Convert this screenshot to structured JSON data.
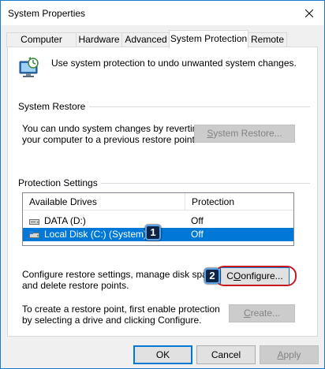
{
  "window": {
    "title": "System Properties",
    "close_icon": "close-icon"
  },
  "tabs": [
    {
      "label": "Computer Name",
      "active": false
    },
    {
      "label": "Hardware",
      "active": false
    },
    {
      "label": "Advanced",
      "active": false
    },
    {
      "label": "System Protection",
      "active": true
    },
    {
      "label": "Remote",
      "active": false
    }
  ],
  "intro": {
    "icon": "computer-shield-icon",
    "text": "Use system protection to undo unwanted system changes."
  },
  "system_restore": {
    "heading": "System Restore",
    "description_line1": "You can undo system changes by reverting",
    "description_line2": "your computer to a previous restore point.",
    "button_label_u": "S",
    "button_label_rest": "ystem Restore..."
  },
  "protection_settings": {
    "heading": "Protection Settings",
    "columns": [
      "Available Drives",
      "Protection"
    ],
    "drives": [
      {
        "name": "DATA (D:)",
        "protection": "Off",
        "selected": false,
        "icon": "drive-icon"
      },
      {
        "name": "Local Disk (C:) (System)",
        "protection": "Off",
        "selected": true,
        "icon": "system-drive-icon"
      }
    ]
  },
  "configure": {
    "description_line1": "Configure restore settings, manage disk space,",
    "description_line2": "and delete restore points.",
    "button_label_u": "O",
    "button_label_rest": "onfigure...",
    "button_label_prefix": "C"
  },
  "create": {
    "description_line1": "To create a restore point, first enable protection",
    "description_line2": "by selecting a drive and clicking Configure.",
    "button_label_u": "C",
    "button_label_rest": "reate..."
  },
  "markers": [
    "1",
    "2"
  ],
  "footer": {
    "ok": "OK",
    "cancel": "Cancel",
    "apply_u": "A",
    "apply_rest": "pply"
  },
  "colors": {
    "accent": "#0078d7",
    "highlight_ring": "#c8191e",
    "marker_bg": "#0c2547"
  }
}
